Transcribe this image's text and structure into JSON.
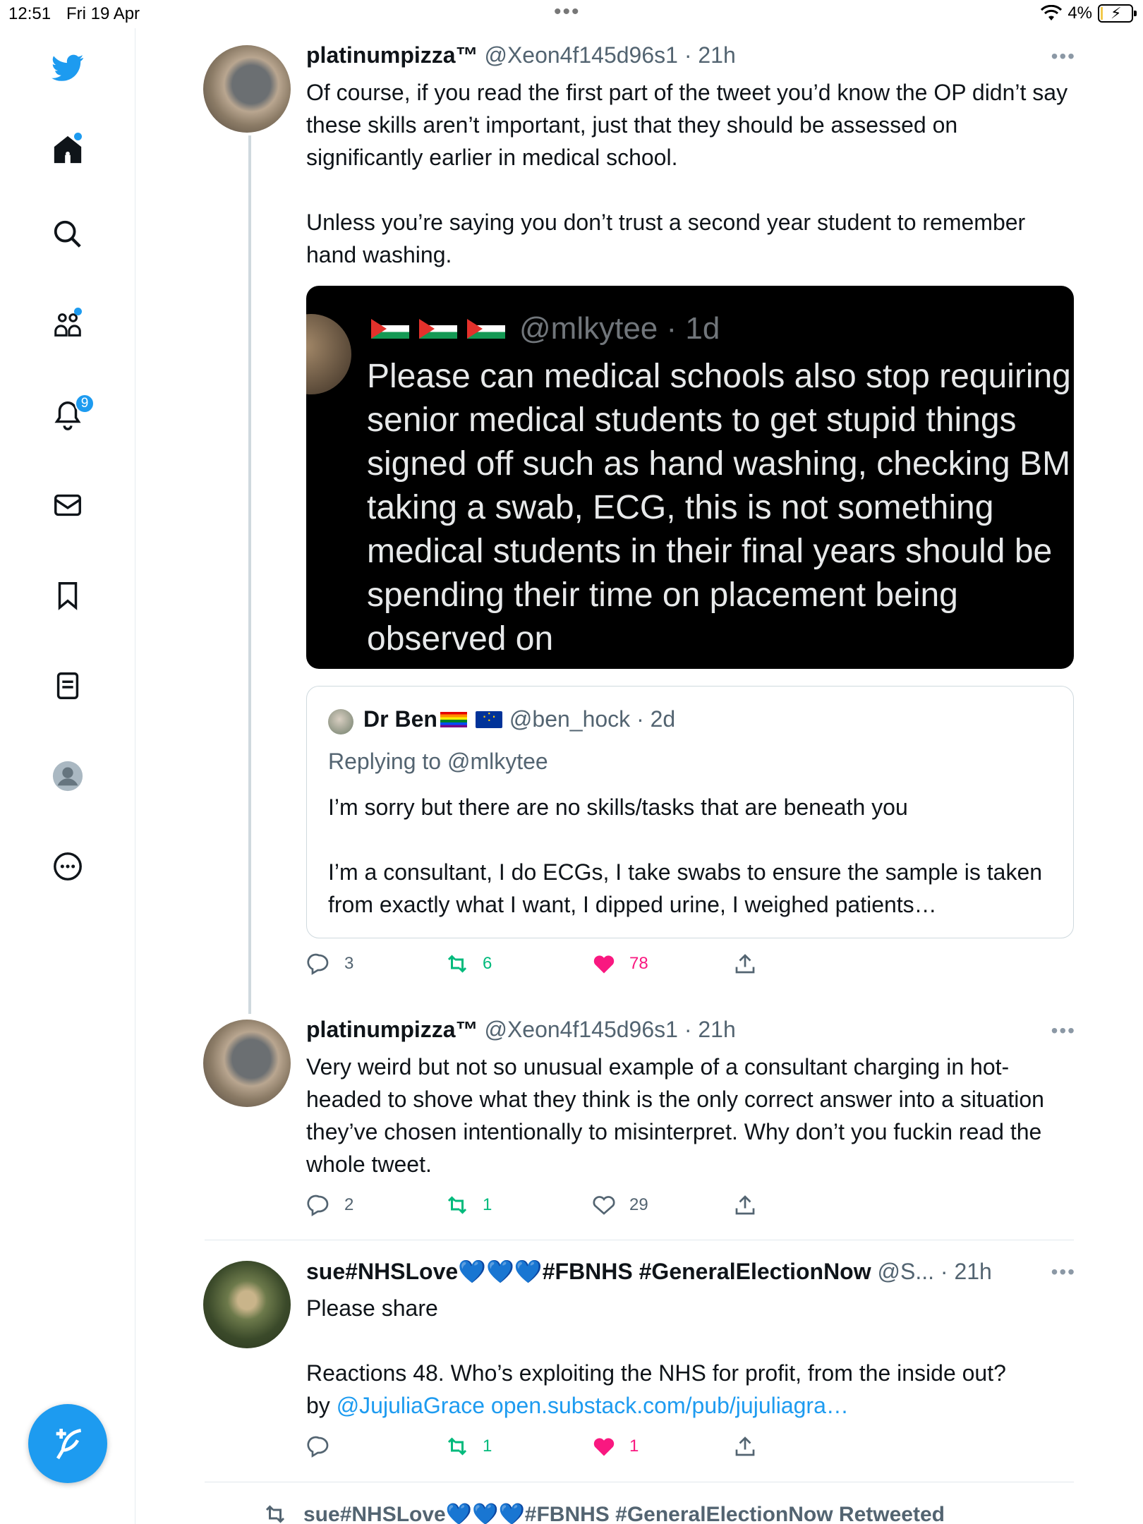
{
  "status_bar": {
    "time": "12:51",
    "date": "Fri 19 Apr",
    "dots": "•••",
    "battery": "4%"
  },
  "sidebar": {
    "notifications_count": "9",
    "items": [
      "twitter-logo",
      "home-icon",
      "search-icon",
      "communities-icon",
      "notifications-icon",
      "messages-icon",
      "bookmarks-icon",
      "lists-icon",
      "profile-icon",
      "more-icon"
    ]
  },
  "tweets": [
    {
      "name": "platinumpizza™",
      "handle": "@Xeon4f145d96s1 · 21h",
      "text": "Of course, if you read the first part of the tweet you’d know the OP didn’t say these skills aren’t important, just that they should be assessed on significantly earlier in medical school.\n\nUnless you’re saying you don’t trust a second year student to remember hand washing.",
      "replies": "3",
      "retweets": "6",
      "likes": "78",
      "image": {
        "handle": "@mlkytee · 1d",
        "text": "Please can medical schools also stop requiring\nsenior medical students to get stupid things\nsigned off such as hand washing, checking BM\ntaking a swab, ECG, this is not something\nmedical students in their final years should be\nspending their time on placement being\nobserved on"
      },
      "quote": {
        "name": "Dr Ben",
        "handle": "@ben_hock · 2d",
        "replying_to": "Replying to @mlkytee",
        "text": "I’m sorry but there are no skills/tasks that are beneath you\n\nI’m a consultant, I do ECGs, I take swabs to ensure the sample is taken from exactly what I want, I dipped urine, I weighed patients…"
      }
    },
    {
      "name": "platinumpizza™",
      "handle": "@Xeon4f145d96s1 · 21h",
      "text": "Very weird but not so unusual example of a consultant charging in hot-headed to shove what they think is the only correct answer into a situation they’ve chosen intentionally to misinterpret. Why don’t you fuckin read the whole tweet.",
      "replies": "2",
      "retweets": "1",
      "likes": "29"
    },
    {
      "name": "sue#NHSLove💙💙💙#FBNHS #GeneralElectionNow",
      "handle": "@S... · 21h",
      "text_1": "Please share",
      "text_2": "Reactions 48. Who’s exploiting the NHS for profit, from the inside out?",
      "text_3_prefix": "by ",
      "mention": "@JujuliaGrace",
      "url": "open.substack.com/pub/jujuliagra…",
      "replies": "",
      "retweets": "1",
      "likes": "1"
    }
  ],
  "retweeted_by": "sue#NHSLove💙💙💙#FBNHS #GeneralElectionNow Retweeted",
  "colors": {
    "accent": "#1d9bf0",
    "retweet": "#00ba7c",
    "like": "#f91880",
    "secondary": "#536471"
  }
}
